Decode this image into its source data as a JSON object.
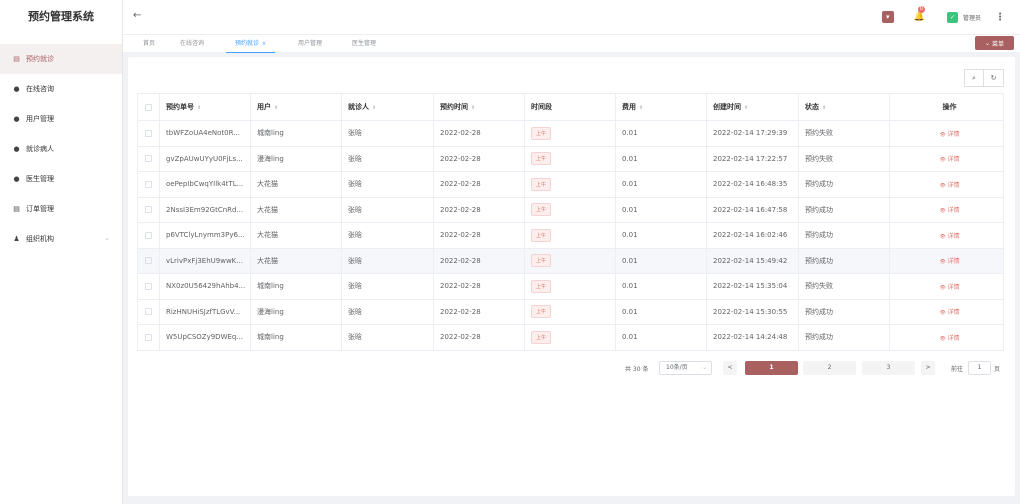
{
  "app": {
    "title": "预约管理系统"
  },
  "sidebar": {
    "items": [
      {
        "label": "预约就诊",
        "icon": "calendar-icon",
        "glyph": "▤"
      },
      {
        "label": "在线咨询",
        "icon": "pin-icon",
        "glyph": "●"
      },
      {
        "label": "用户管理",
        "icon": "user-icon",
        "glyph": "●"
      },
      {
        "label": "就诊病人",
        "icon": "users-icon",
        "glyph": "●"
      },
      {
        "label": "医生管理",
        "icon": "user-icon",
        "glyph": "●"
      },
      {
        "label": "订单管理",
        "icon": "order-icon",
        "glyph": "▤"
      },
      {
        "label": "组织机构",
        "icon": "org-icon",
        "glyph": "♟"
      }
    ]
  },
  "header": {
    "back": "←",
    "badge": "0",
    "bell": "🔔",
    "avatar_glyph": "✓",
    "user": "管理员",
    "more": "⋮",
    "square_glyph": "▾"
  },
  "tabs": [
    {
      "label": "首页"
    },
    {
      "label": "在线咨询"
    },
    {
      "label": "预约就诊",
      "close": "×"
    },
    {
      "label": "用户管理"
    },
    {
      "label": "医生管理"
    }
  ],
  "menu_button": {
    "label": "菜单",
    "icon": "⌄"
  },
  "tools": {
    "search": "⌕",
    "refresh": "↻"
  },
  "table": {
    "sort_glyph": "⬍",
    "headers": [
      "预约单号",
      "用户",
      "就诊人",
      "预约时间",
      "时间段",
      "费用",
      "创建时间",
      "状态",
      "操作"
    ],
    "rows": [
      [
        "tbWFZoUA4eNot0R...",
        "城南ling",
        "张晗",
        "2022-02-28",
        "上午",
        "0.01",
        "2022-02-14 17:29:39",
        "预约失败",
        "详情"
      ],
      [
        "gvZpAUwUYyU0FjLs...",
        "漫海ling",
        "张晗",
        "2022-02-28",
        "上午",
        "0.01",
        "2022-02-14 17:22:57",
        "预约失败",
        "详情"
      ],
      [
        "oePepIbCwqYIlk4tTL...",
        "大花猫",
        "张晗",
        "2022-02-28",
        "上午",
        "0.01",
        "2022-02-14 16:48:35",
        "预约成功",
        "详情"
      ],
      [
        "2NssI3Em92GtCnRd...",
        "大花猫",
        "张晗",
        "2022-02-28",
        "上午",
        "0.01",
        "2022-02-14 16:47:58",
        "预约成功",
        "详情"
      ],
      [
        "p6VTClyLnymm3Py6...",
        "大花猫",
        "张晗",
        "2022-02-28",
        "上午",
        "0.01",
        "2022-02-14 16:02:46",
        "预约成功",
        "详情"
      ],
      [
        "vLrivPxFj3EhU9wwK...",
        "大花猫",
        "张晗",
        "2022-02-28",
        "上午",
        "0.01",
        "2022-02-14 15:49:42",
        "预约成功",
        "详情"
      ],
      [
        "NX0z0U56429hAhb4...",
        "城南ling",
        "张晗",
        "2022-02-28",
        "上午",
        "0.01",
        "2022-02-14 15:35:04",
        "预约失败",
        "详情"
      ],
      [
        "RizHNUHiSJzfTLGvV...",
        "漫海ling",
        "张晗",
        "2022-02-28",
        "上午",
        "0.01",
        "2022-02-14 15:30:55",
        "预约成功",
        "详情"
      ],
      [
        "W5UpCSOZy9DWEq...",
        "城南ling",
        "张晗",
        "2022-02-28",
        "上午",
        "0.01",
        "2022-02-14 14:24:48",
        "预约成功",
        "详情"
      ]
    ]
  },
  "pagination": {
    "total": "共 30 条",
    "page_size": "10条/页",
    "prev": "<",
    "next": ">",
    "pages": [
      "1",
      "2",
      "3"
    ],
    "goto_label": "前往",
    "goto_value": "1",
    "goto_unit": "页"
  },
  "colors": {
    "accent": "#a96060",
    "tab_active": "#409eff",
    "tag": "#e3736a"
  }
}
